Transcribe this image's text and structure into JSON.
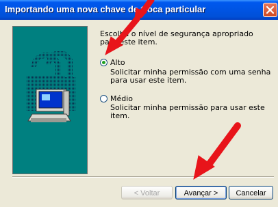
{
  "window": {
    "title": "Importando uma nova chave de troca particular"
  },
  "dialog": {
    "prompt": "Escolha o nível de segurança apropriado para este item.",
    "options": [
      {
        "label": "Alto",
        "description": "Solicitar minha permissão com uma senha para usar este item.",
        "selected": true
      },
      {
        "label": "Médio",
        "description": "Solicitar minha permissão para usar este item.",
        "selected": false
      }
    ]
  },
  "buttons": {
    "back": "< Voltar",
    "next": "Avançar >",
    "cancel": "Cancelar"
  },
  "annotations": {
    "arrow_color": "#e8141a"
  },
  "colors": {
    "side_panel": "#008080",
    "titlebar": "#0054e3",
    "close_button": "#d04a22"
  }
}
